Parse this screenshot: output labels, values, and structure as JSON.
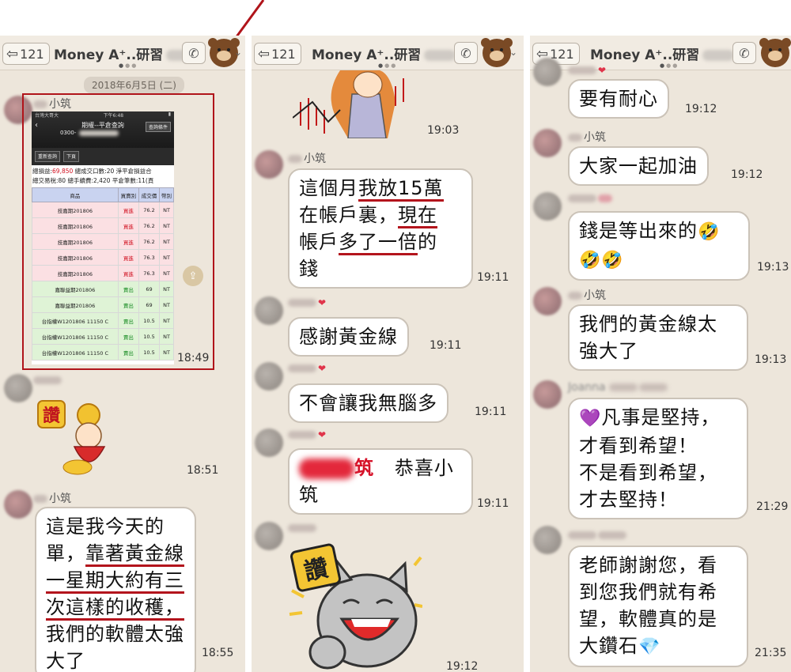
{
  "header": {
    "back_count": "121",
    "title": "Money A⁺..研習",
    "title_suffix_blurred": "(186)"
  },
  "panel1": {
    "date": "2018年6月5日 (二)",
    "sender_xiaozhu": "小筑",
    "screenshot": {
      "carrier": "台灣大哥大",
      "clock": "下午6:48",
      "title": "期權--平倉查詢",
      "account": "0300-",
      "query_btn": "查詢條件",
      "btn_requery": "重新查詢",
      "btn_next": "下頁",
      "summary_line1_prefix": "總損益:",
      "summary_pnl": "69,850",
      "summary_line1_suffix": " 總成交口數:20 淨平倉損益合",
      "summary_line2": "總交易稅:80 總手續費:2,420 平倉筆數:11(頁",
      "columns": [
        "商品",
        "買賣別",
        "成交價",
        "幣別"
      ],
      "rows": [
        {
          "product": "技嘉期201806",
          "side": "買進",
          "price": "76.2",
          "cur": "NT",
          "kind": "buy"
        },
        {
          "product": "技嘉期201806",
          "side": "買進",
          "price": "76.2",
          "cur": "NT",
          "kind": "buy"
        },
        {
          "product": "技嘉期201806",
          "side": "買進",
          "price": "76.2",
          "cur": "NT",
          "kind": "buy"
        },
        {
          "product": "技嘉期201806",
          "side": "買進",
          "price": "76.3",
          "cur": "NT",
          "kind": "buy"
        },
        {
          "product": "技嘉期201806",
          "side": "買進",
          "price": "76.3",
          "cur": "NT",
          "kind": "buy"
        },
        {
          "product": "嘉聯益期201806",
          "side": "賣出",
          "price": "69",
          "cur": "NT",
          "kind": "sell"
        },
        {
          "product": "嘉聯益期201806",
          "side": "賣出",
          "price": "69",
          "cur": "NT",
          "kind": "sell"
        },
        {
          "product": "台指權W1201806 11150 C",
          "side": "賣出",
          "price": "10.5",
          "cur": "NT",
          "kind": "sell"
        },
        {
          "product": "台指權W1201806 11150 C",
          "side": "賣出",
          "price": "10.5",
          "cur": "NT",
          "kind": "sell"
        },
        {
          "product": "台指權W1201806 11150 C",
          "side": "賣出",
          "price": "10.5",
          "cur": "NT",
          "kind": "sell"
        }
      ]
    },
    "time_screenshot": "18:49",
    "sender_2": "大哥",
    "sticker1_text": "讚",
    "time_sticker1": "18:51",
    "msg_line1": "這是我今天的",
    "msg_line2a": "單，",
    "msg_line2b": "靠著黃金線",
    "msg_line3": "一星期大約有三",
    "msg_line4": "次這樣的收穫，",
    "msg_line5": "我們的軟體太強",
    "msg_line6": "大了",
    "time_msg": "18:55"
  },
  "panel2": {
    "time_top": "19:03",
    "sender_xiaozhu": "小筑",
    "m1_l1a": "這個月",
    "m1_l1b": "我放15萬",
    "m1_l2a": "在帳戶裏，",
    "m1_l2b": "現在",
    "m1_l3a": "帳戶",
    "m1_l3b": "多了一倍",
    "m1_l3c": "的",
    "m1_l4": "錢",
    "time_m1": "19:11",
    "m2": "感謝黃金線",
    "time_m2": "19:11",
    "m3": "不會讓我無腦多",
    "time_m3": "19:11",
    "m4_red": "筑",
    "m4_a": "恭喜小",
    "m4_b": "筑",
    "time_m4": "19:11",
    "sender_last": "Angel",
    "sticker2_text": "讚",
    "time_sticker2": "19:12"
  },
  "panel3": {
    "m1": "要有耐心",
    "time_m1": "19:12",
    "sender_xiaozhu": "小筑",
    "m2": "大家一起加油",
    "time_m2": "19:12",
    "m3_l1": "錢是等出來的",
    "time_m3": "19:13",
    "m4_l1": "我們的黃金線太",
    "m4_l2": "強大了",
    "time_m4": "19:13",
    "sender_joanna": "Joanna",
    "m5_l1": "凡事是堅持，",
    "m5_l2": "才看到希望！",
    "m5_l3": "不是看到希望，",
    "m5_l4": "才去堅持！",
    "time_m5": "21:29",
    "m6_l1": "老師謝謝您，看",
    "m6_l2": "到您我們就有希",
    "m6_l3": "望，軟體真的是",
    "m6_l4": "大鑽石",
    "time_m6": "21:35"
  },
  "colors": {
    "chat_bg": "#ede6db",
    "underline_red": "#b3141c",
    "highlight_frame": "#b0141a"
  }
}
